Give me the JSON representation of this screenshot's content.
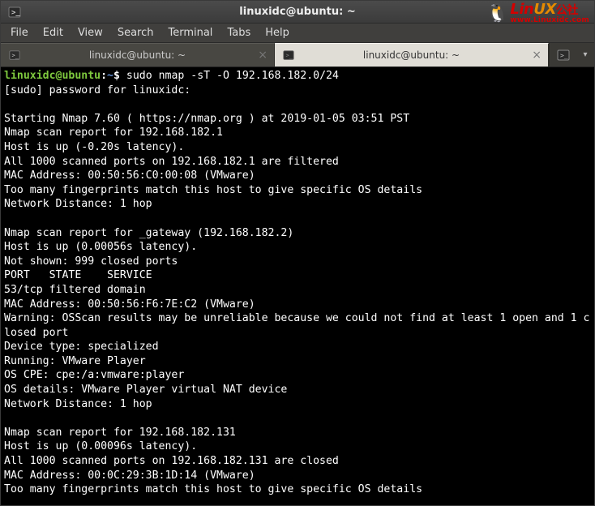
{
  "window": {
    "title": "linuxidc@ubuntu: ~"
  },
  "watermark": {
    "brand_red": "Lin",
    "brand_gold": "UX",
    "brand_suffix": "公社",
    "url": "www.Linuxidc.com"
  },
  "menu": {
    "file": "File",
    "edit": "Edit",
    "view": "View",
    "search": "Search",
    "terminal": "Terminal",
    "tabs": "Tabs",
    "help": "Help"
  },
  "tabs": [
    {
      "label": "linuxidc@ubuntu: ~",
      "active": false
    },
    {
      "label": "linuxidc@ubuntu: ~",
      "active": true
    }
  ],
  "prompt": {
    "user_host": "linuxidc@ubuntu",
    "sep": ":",
    "path": "~",
    "symbol": "$",
    "command": "sudo nmap -sT -O 192.168.182.0/24"
  },
  "output_lines": [
    "[sudo] password for linuxidc:",
    "",
    "Starting Nmap 7.60 ( https://nmap.org ) at 2019-01-05 03:51 PST",
    "Nmap scan report for 192.168.182.1",
    "Host is up (-0.20s latency).",
    "All 1000 scanned ports on 192.168.182.1 are filtered",
    "MAC Address: 00:50:56:C0:00:08 (VMware)",
    "Too many fingerprints match this host to give specific OS details",
    "Network Distance: 1 hop",
    "",
    "Nmap scan report for _gateway (192.168.182.2)",
    "Host is up (0.00056s latency).",
    "Not shown: 999 closed ports",
    "PORT   STATE    SERVICE",
    "53/tcp filtered domain",
    "MAC Address: 00:50:56:F6:7E:C2 (VMware)",
    "Warning: OSScan results may be unreliable because we could not find at least 1 open and 1 closed port",
    "Device type: specialized",
    "Running: VMware Player",
    "OS CPE: cpe:/a:vmware:player",
    "OS details: VMware Player virtual NAT device",
    "Network Distance: 1 hop",
    "",
    "Nmap scan report for 192.168.182.131",
    "Host is up (0.00096s latency).",
    "All 1000 scanned ports on 192.168.182.131 are closed",
    "MAC Address: 00:0C:29:3B:1D:14 (VMware)",
    "Too many fingerprints match this host to give specific OS details"
  ]
}
